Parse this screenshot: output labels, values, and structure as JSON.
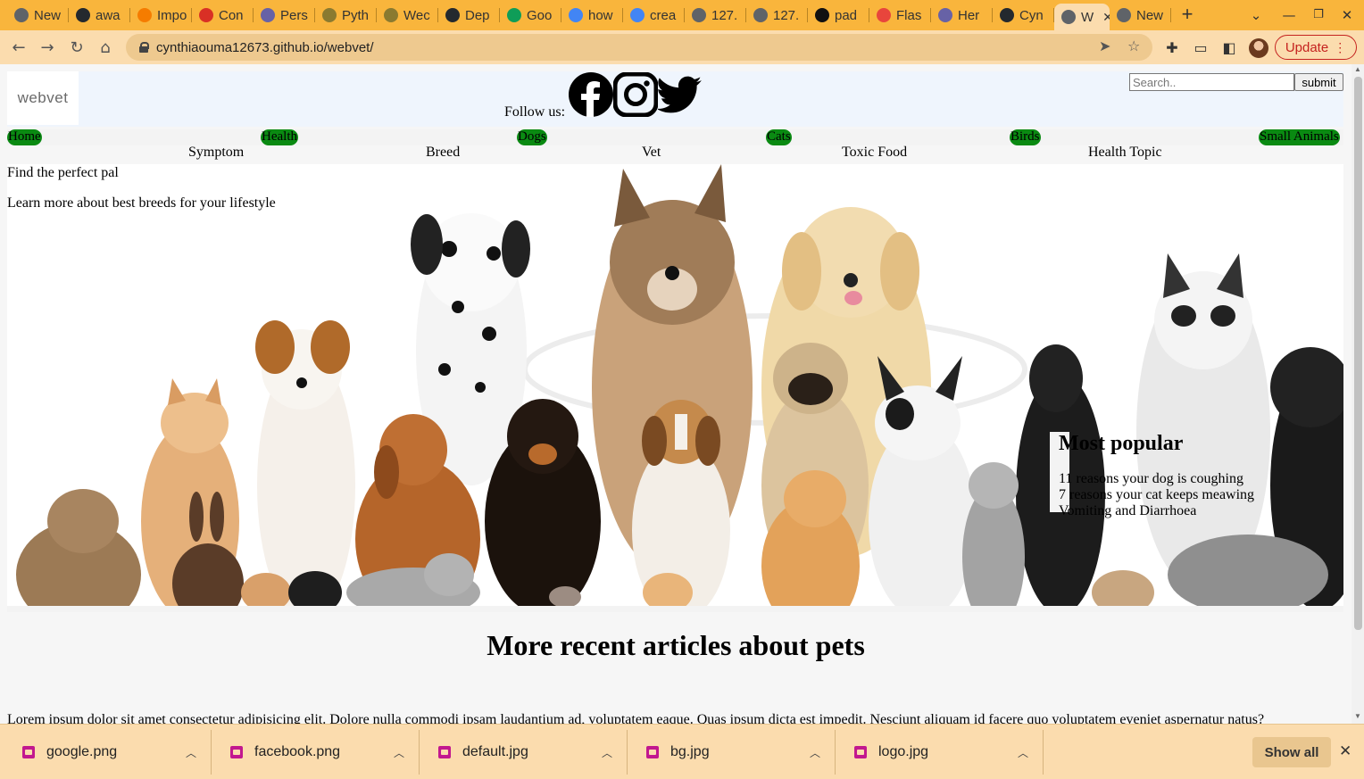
{
  "browser": {
    "tabs": [
      {
        "title": "New",
        "icon": "chrome-icon",
        "color": "#5f6368"
      },
      {
        "title": "awa",
        "icon": "github-icon",
        "color": "#24292e"
      },
      {
        "title": "Impo",
        "icon": "firebase-icon",
        "color": "#f57c00"
      },
      {
        "title": "Con",
        "icon": "gmail-icon",
        "color": "#d93025"
      },
      {
        "title": "Pers",
        "icon": "heroku-icon",
        "color": "#6762a6"
      },
      {
        "title": "Pyth",
        "icon": "tree-icon",
        "color": "#8a7a30"
      },
      {
        "title": "Wec",
        "icon": "tree-icon",
        "color": "#8a7a30"
      },
      {
        "title": "Dep",
        "icon": "github-icon",
        "color": "#24292e"
      },
      {
        "title": "Goo",
        "icon": "drive-icon",
        "color": "#0f9d58"
      },
      {
        "title": "how",
        "icon": "google-icon",
        "color": "#4285f4"
      },
      {
        "title": "crea",
        "icon": "google-icon",
        "color": "#4285f4"
      },
      {
        "title": "127.",
        "icon": "globe-icon",
        "color": "#5f6368"
      },
      {
        "title": "127.",
        "icon": "globe-icon",
        "color": "#5f6368"
      },
      {
        "title": "pad",
        "icon": "medium-icon",
        "color": "#111111"
      },
      {
        "title": "Flas",
        "icon": "flask-icon",
        "color": "#e8453c"
      },
      {
        "title": "Her",
        "icon": "heroku-icon",
        "color": "#6762a6"
      },
      {
        "title": "Cyn",
        "icon": "github-icon",
        "color": "#24292e"
      },
      {
        "title": "W",
        "icon": "chrome-icon",
        "color": "#5f6368",
        "active": true
      },
      {
        "title": "New",
        "icon": "chrome-icon",
        "color": "#5f6368"
      }
    ],
    "url": "cynthiaouma12673.github.io/webvet/",
    "update_label": "Update"
  },
  "site": {
    "logo_text": "webvet",
    "follow_label": "Follow us:",
    "search_placeholder": "Search..",
    "submit_label": "submit",
    "nav": [
      "Home",
      "Health",
      "Dogs",
      "Cats",
      "Birds",
      "Small Animals"
    ],
    "subnav": [
      "Symptom",
      "Breed",
      "Vet",
      "Toxic Food",
      "Health Topic"
    ],
    "hero_heading": "Find the perfect pal",
    "hero_subheading": "Learn more about best breeds for your lifestyle",
    "popular_title": "Most popular",
    "popular_items": [
      "11 reasons your dog is coughing",
      "7 reasons your cat keeps meawing",
      "Vomiting and Diarrhoea"
    ],
    "articles_title": "More recent articles about pets",
    "lorem": "Lorem ipsum dolor sit amet consectetur adipisicing elit. Dolore nulla commodi ipsam laudantium ad, voluptatem eaque. Quas ipsum dicta est impedit. Nesciunt aliquam id facere quo voluptatem eveniet aspernatur natus?",
    "colors": {
      "nav_pill": "#0a8a12",
      "header_bg": "#eff5fd"
    }
  },
  "downloads": {
    "items": [
      "google.png",
      "facebook.png",
      "default.jpg",
      "bg.jpg",
      "logo.jpg"
    ],
    "show_all_label": "Show all"
  }
}
